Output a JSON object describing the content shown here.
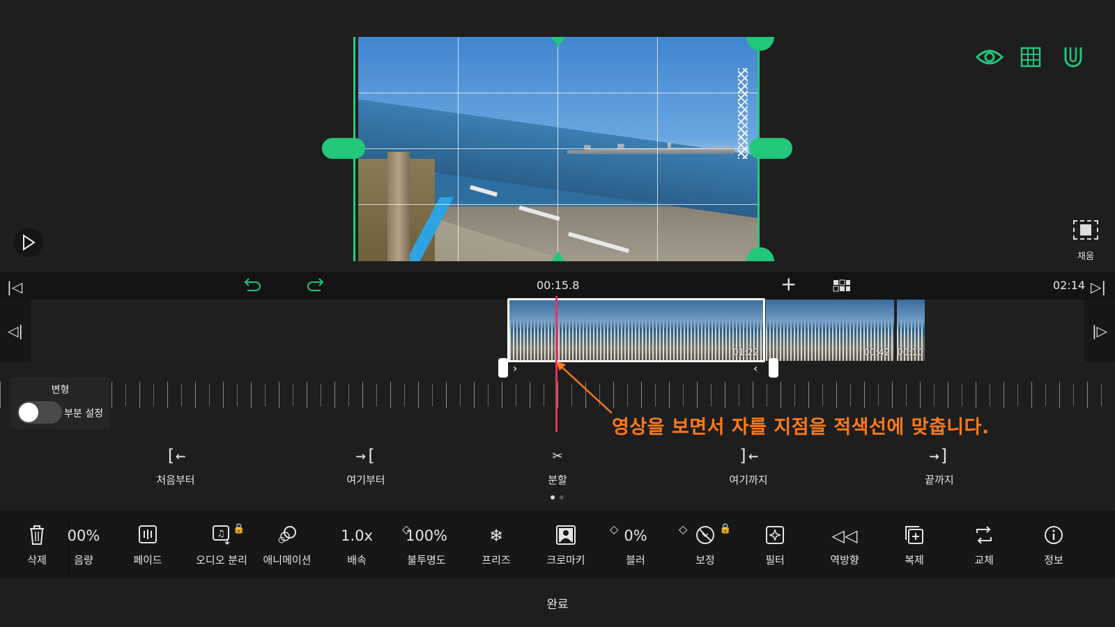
{
  "preview": {
    "fill_label": "채움",
    "icons": [
      "eye-icon",
      "grid-icon",
      "magnet-icon",
      "play-icon",
      "fill-icon"
    ],
    "accent_color": "#22c77a"
  },
  "timeline": {
    "current_time": "00:15.8",
    "total_time": "02:14",
    "clips": [
      {
        "duration": "01:22"
      },
      {
        "duration": "00:42"
      },
      {
        "duration": "00:10"
      }
    ],
    "playhead_color": "#e8335a"
  },
  "transform_panel": {
    "title": "변형",
    "toggle_label": "부분 설정",
    "toggle_on": false
  },
  "annotation": {
    "text": "영상을 보면서 자를 지점을 적색선에 맞춥니다.",
    "color": "#ff7a1a"
  },
  "trim_actions": [
    {
      "label": "처음부터",
      "icon": "trim-from-start-icon"
    },
    {
      "label": "여기부터",
      "icon": "trim-from-here-icon"
    },
    {
      "label": "분할",
      "icon": "split-scissors-icon"
    },
    {
      "label": "여기까지",
      "icon": "trim-to-here-icon"
    },
    {
      "label": "끝까지",
      "icon": "trim-to-end-icon"
    }
  ],
  "tools": [
    {
      "label": "삭제",
      "icon": "trash-icon"
    },
    {
      "label": "음량",
      "value": "00%"
    },
    {
      "label": "페이드",
      "icon": "fade-icon"
    },
    {
      "label": "오디오 분리",
      "icon": "audio-separate-icon",
      "locked": true
    },
    {
      "label": "애니메이션",
      "icon": "animation-icon"
    },
    {
      "label": "배속",
      "value": "1.0x"
    },
    {
      "label": "불투명도",
      "value": "100%",
      "keyframe": true
    },
    {
      "label": "프리즈",
      "icon": "freeze-icon"
    },
    {
      "label": "크로마키",
      "icon": "chroma-key-icon"
    },
    {
      "label": "블러",
      "value": "0%",
      "keyframe": true
    },
    {
      "label": "보정",
      "icon": "adjust-icon",
      "keyframe": true,
      "locked": true
    },
    {
      "label": "필터",
      "icon": "filter-icon"
    },
    {
      "label": "역방향",
      "icon": "reverse-icon"
    },
    {
      "label": "복제",
      "icon": "duplicate-icon"
    },
    {
      "label": "교체",
      "icon": "replace-icon"
    },
    {
      "label": "정보",
      "icon": "info-icon"
    }
  ],
  "done_label": "완료",
  "glyphs": {
    "eye": "◉",
    "play": "▷",
    "undo": "↶",
    "redo": "↷",
    "add": "+",
    "prev_start": "|◁",
    "next_end": "▷|",
    "prev_frame": "◁|",
    "next_frame": "|▷",
    "chev_right": "›",
    "chev_left": "‹",
    "trash": "🗑",
    "fade": "▥",
    "audio_sep": "♫",
    "animation": "⊘",
    "freeze": "❄",
    "chroma": "▣",
    "adjust": "⊘",
    "filter": "✧",
    "reverse": "◁◁",
    "duplicate": "⧉",
    "replace": "⇆",
    "info": "ⓘ",
    "lock": "🔒",
    "diamond": "◇",
    "trim_start": "[←",
    "trim_here_start": "→[",
    "split": "✂",
    "trim_here_end": "]←",
    "trim_end": "→]"
  }
}
